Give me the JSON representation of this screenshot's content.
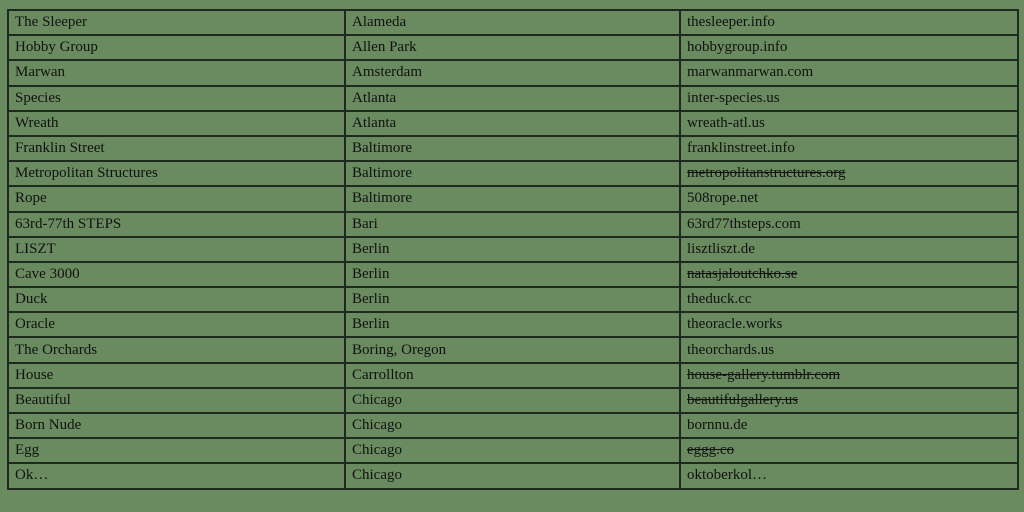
{
  "table": {
    "rows": [
      {
        "name": "The Sleeper",
        "city": "Alameda",
        "url": "thesleeper.info",
        "struck": false
      },
      {
        "name": "Hobby Group",
        "city": "Allen Park",
        "url": "hobbygroup.info",
        "struck": false
      },
      {
        "name": "Marwan",
        "city": "Amsterdam",
        "url": "marwanmarwan.com",
        "struck": false
      },
      {
        "name": "Species",
        "city": "Atlanta",
        "url": "inter-species.us",
        "struck": false
      },
      {
        "name": "Wreath",
        "city": "Atlanta",
        "url": "wreath-atl.us",
        "struck": false
      },
      {
        "name": "Franklin Street",
        "city": "Baltimore",
        "url": "franklinstreet.info",
        "struck": false
      },
      {
        "name": "Metropolitan Structures",
        "city": "Baltimore",
        "url": "metropolitanstructures.org",
        "struck": true
      },
      {
        "name": "Rope",
        "city": "Baltimore",
        "url": "508rope.net",
        "struck": false
      },
      {
        "name": "63rd-77th STEPS",
        "city": "Bari",
        "url": "63rd77thsteps.com",
        "struck": false
      },
      {
        "name": "LISZT",
        "city": "Berlin",
        "url": "lisztliszt.de",
        "struck": false
      },
      {
        "name": "Cave 3000",
        "city": "Berlin",
        "url": "natasjaloutchko.se",
        "struck": true
      },
      {
        "name": "Duck",
        "city": "Berlin",
        "url": "theduck.cc",
        "struck": false
      },
      {
        "name": "Oracle",
        "city": "Berlin",
        "url": "theoracle.works",
        "struck": false
      },
      {
        "name": "The Orchards",
        "city": "Boring, Oregon",
        "url": "theorchards.us",
        "struck": false
      },
      {
        "name": "House",
        "city": "Carrollton",
        "url": "house-gallery.tumblr.com",
        "struck": true
      },
      {
        "name": "Beautiful",
        "city": "Chicago",
        "url": "beautifulgallery.us",
        "struck": true
      },
      {
        "name": "Born Nude",
        "city": "Chicago",
        "url": "bornnu.de",
        "struck": false
      },
      {
        "name": "Egg",
        "city": "Chicago",
        "url": "eggg.co",
        "struck": true
      },
      {
        "name": "Ok…",
        "city": "Chicago",
        "url": "oktoberkol…",
        "struck": false
      }
    ]
  }
}
